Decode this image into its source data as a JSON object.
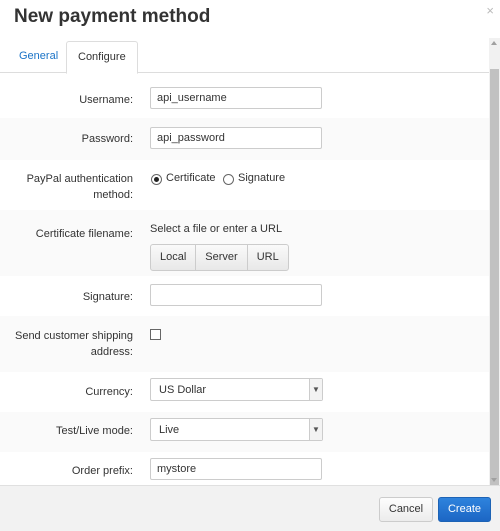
{
  "dialog": {
    "title": "New payment method",
    "close_glyph": "×"
  },
  "tabs": [
    {
      "label": "General"
    },
    {
      "label": "Configure"
    }
  ],
  "form": {
    "username": {
      "label": "Username:",
      "value": "api_username"
    },
    "password": {
      "label": "Password:",
      "value": "api_password"
    },
    "auth_method": {
      "label_line1": "PayPal authentication",
      "label_line2": "method:",
      "options": [
        {
          "label": "Certificate",
          "selected": true
        },
        {
          "label": "Signature",
          "selected": false
        }
      ]
    },
    "certificate": {
      "label": "Certificate filename:",
      "hint": "Select a file or enter a URL",
      "sources": [
        "Local",
        "Server",
        "URL"
      ]
    },
    "signature": {
      "label": "Signature:",
      "value": ""
    },
    "shipping": {
      "label_line1": "Send customer shipping",
      "label_line2": "address:",
      "checked": false
    },
    "currency": {
      "label": "Currency:",
      "value": "US Dollar"
    },
    "mode": {
      "label": "Test/Live mode:",
      "value": "Live"
    },
    "order_prefix": {
      "label": "Order prefix:",
      "value": "mystore"
    }
  },
  "footer": {
    "cancel_label": "Cancel",
    "create_label": "Create"
  },
  "colors": {
    "accent": "#1a73c7",
    "primary_button": "#1c66c4"
  }
}
